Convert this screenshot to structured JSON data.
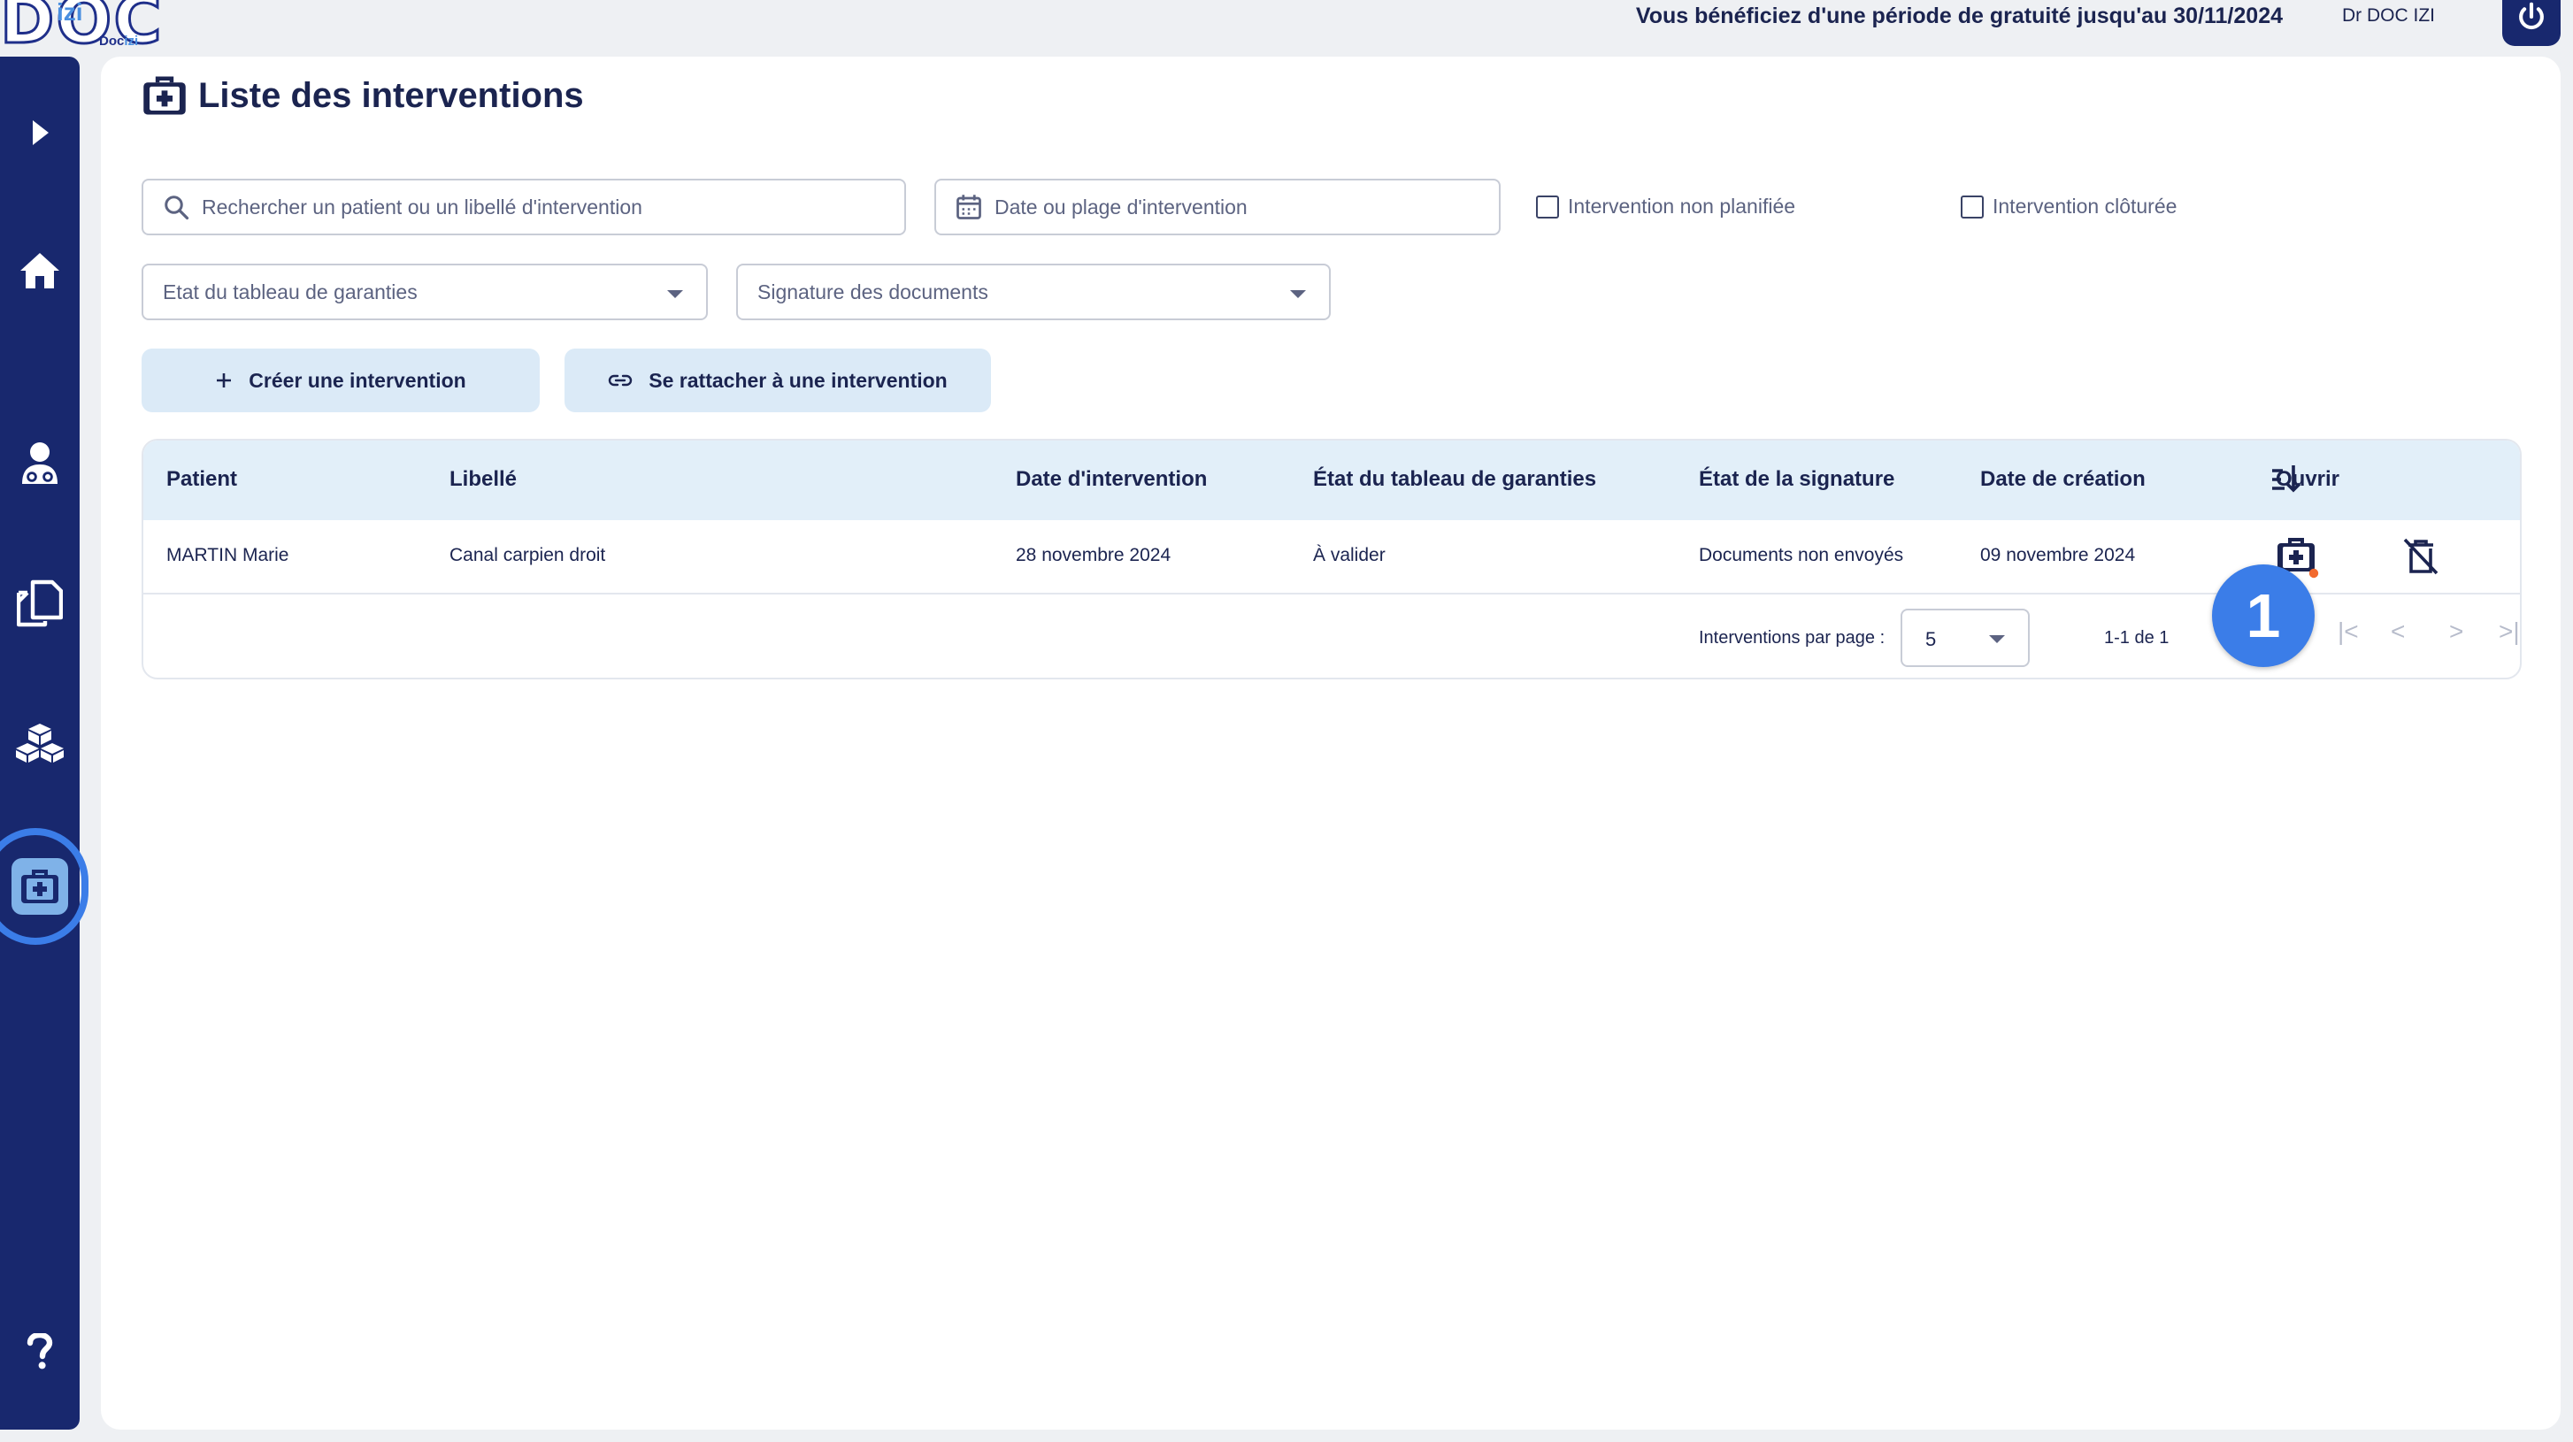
{
  "brand": {
    "logo_letters": "DOC",
    "logo_izi": "izi",
    "logo_sub_a": "Doc",
    "logo_sub_b": "izi"
  },
  "topbar": {
    "trial_notice": "Vous bénéficiez d'une période de gratuité jusqu'au 30/11/2024",
    "user_name": "Dr DOC IZI",
    "power_icon": "power-icon"
  },
  "sidebar": {
    "items": [
      {
        "icon": "expand-arrow-icon"
      },
      {
        "icon": "home-icon"
      },
      {
        "icon": "doctor-icon"
      },
      {
        "icon": "documents-icon"
      },
      {
        "icon": "boxes-icon"
      },
      {
        "icon": "medical-case-icon",
        "active": true
      },
      {
        "icon": "help-icon"
      }
    ]
  },
  "page": {
    "title": "Liste des interventions"
  },
  "filters": {
    "search_placeholder": "Rechercher un patient ou un libellé d'intervention",
    "date_placeholder": "Date ou plage d'intervention",
    "unplanned_label": "Intervention non planifiée",
    "closed_label": "Intervention clôturée",
    "guarantee_state_placeholder": "Etat du tableau de garanties",
    "signature_placeholder": "Signature des documents"
  },
  "actions": {
    "create_label": "Créer une intervention",
    "attach_label": "Se rattacher à une intervention"
  },
  "table": {
    "headers": {
      "patient": "Patient",
      "label": "Libellé",
      "date": "Date d'intervention",
      "guarantee_state": "État du tableau de garanties",
      "signature_state": "État de la signature",
      "created": "Date de création",
      "open": "Ouvrir"
    },
    "rows": [
      {
        "patient": "MARTIN Marie",
        "label": "Canal carpien droit",
        "date": "28 novembre 2024",
        "guarantee_state": "À valider",
        "signature_state": "Documents non envoyés",
        "created": "09 novembre 2024"
      }
    ],
    "footer": {
      "per_page_label": "Interventions par page :",
      "per_page_value": "5",
      "range": "1-1 de 1"
    }
  },
  "annotation": {
    "step_number": "1",
    "color": "#3b7de8"
  },
  "colors": {
    "navy": "#18286e",
    "accent": "#3b7de8",
    "header_bg": "#e2eff9",
    "button_bg": "#dbeaf7",
    "notification_dot": "#f26a2e"
  }
}
